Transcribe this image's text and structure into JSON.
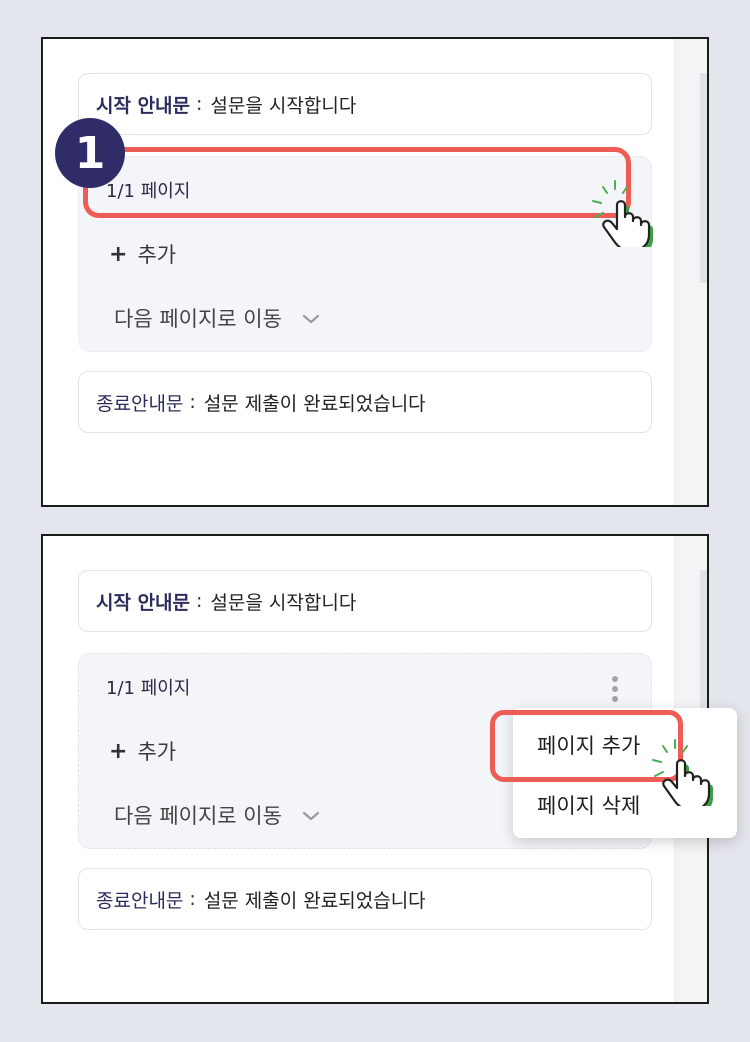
{
  "panels": [
    {
      "start_notice": {
        "label": "시작 안내문",
        "colon": ":",
        "value": "설문을 시작합니다"
      },
      "page": {
        "title": "1/1 페이지",
        "add_label": "추가",
        "next_label": "다음 페이지로 이동"
      },
      "end_notice": {
        "label": "종료안내문",
        "colon": ":",
        "value": "설문 제출이 완료되었습니다"
      },
      "step_badge": "1"
    },
    {
      "start_notice": {
        "label": "시작 안내문",
        "colon": ":",
        "value": "설문을 시작합니다"
      },
      "page": {
        "title": "1/1 페이지",
        "add_label": "추가",
        "next_label": "다음 페이지로 이동"
      },
      "end_notice": {
        "label": "종료안내문",
        "colon": ":",
        "value": "설문 제출이 완료되었습니다"
      },
      "menu": {
        "items": [
          "페이지 추가",
          "페이지 삭제"
        ]
      }
    }
  ],
  "icons": {
    "plus": "plus-icon",
    "chevron": "chevron-down-icon",
    "hand": "pointing-hand-icon",
    "kebab": "kebab-menu-icon"
  },
  "colors": {
    "highlight": "#ee5d55",
    "badge": "#2f2c67",
    "label": "#2c2d5c",
    "hand_shadow": "#4caf50"
  }
}
